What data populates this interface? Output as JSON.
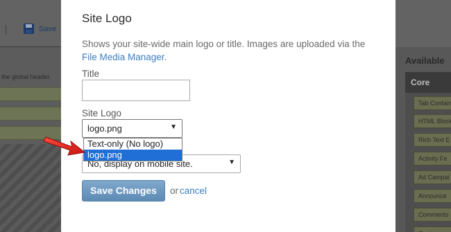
{
  "background": {
    "toolbar": {
      "save_label": "Save"
    },
    "header_note": "the global header.",
    "widgets_panel": {
      "title": "Available",
      "group": "Core",
      "items": [
        "Tab Contain",
        "HTML Block",
        "Rich Text E",
        "Activity Fe",
        "Ad Campai",
        "Announce",
        "Comments",
        "Conten"
      ]
    }
  },
  "modal": {
    "title": "Site Logo",
    "description": "Shows your site-wide main logo or title. Images are uploaded via the ",
    "description_link": "File Media Manager",
    "description_end": ".",
    "title_field": {
      "label": "Title",
      "value": ""
    },
    "site_logo": {
      "label": "Site Logo",
      "selected": "logo.png",
      "options": [
        "Text-only (No logo)",
        "logo.png"
      ],
      "highlighted_index": 1
    },
    "mobile_select": {
      "selected": "No, display on mobile site."
    },
    "save_label": "Save Changes",
    "or_label": "or",
    "cancel_label": "cancel"
  },
  "colors": {
    "accent_link": "#3a7fc1",
    "button": "#6a96be",
    "highlight": "#1f6fd6",
    "annotation": "#e0201a"
  }
}
